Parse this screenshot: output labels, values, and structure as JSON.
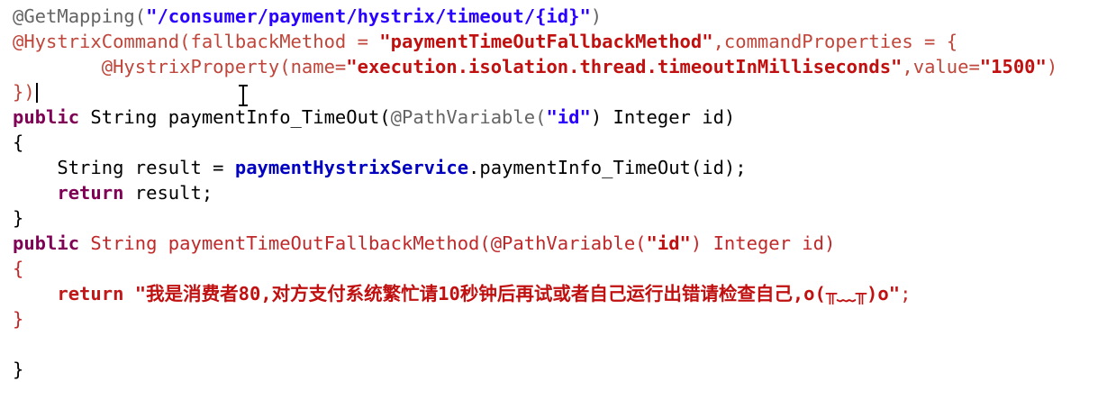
{
  "code": {
    "l1": {
      "annotation": "@GetMapping(",
      "path": "\"/consumer/payment/hystrix/timeout/{id}\"",
      "close": ")"
    },
    "l2": {
      "annotation": "@HystrixCommand(fallbackMethod = ",
      "method_name": "\"paymentTimeOutFallbackMethod\"",
      "rest": ",commandProperties = {"
    },
    "l3": {
      "indent": "        ",
      "annotation": "@HystrixProperty(name=",
      "prop_name": "\"execution.isolation.thread.timeoutInMilliseconds\"",
      "mid": ",value=",
      "prop_value": "\"1500\"",
      "close": ")"
    },
    "l4": {
      "text": "})"
    },
    "l5": {
      "kw": "public",
      "sig": " String paymentInfo_TimeOut(",
      "annotation": "@PathVariable(",
      "arg": "\"id\"",
      "rest": ") Integer id)"
    },
    "l6": {
      "text": "{"
    },
    "l7": {
      "indent": "    ",
      "pre": "String result = ",
      "field": "paymentHystrixService",
      "rest": ".paymentInfo_TimeOut(id);"
    },
    "l8": {
      "indent": "    ",
      "kw": "return",
      "rest": " result;"
    },
    "l9": {
      "text": "}"
    },
    "l10": {
      "kw": "public",
      "sig": " String paymentTimeOutFallbackMethod(",
      "annotation": "@PathVariable(",
      "arg": "\"id\"",
      "rest": ") Integer id)"
    },
    "l11": {
      "text": "{"
    },
    "l12": {
      "indent": "    ",
      "kw": "return",
      "space": " ",
      "msg": "\"我是消费者80,对方支付系统繁忙请10秒钟后再试或者自己运行出错请检查自己,o(╥﹏╥)o\"",
      "semi": ";"
    },
    "l13": {
      "text": "}"
    },
    "l14": {
      "text": ""
    },
    "l15": {
      "text": "}"
    }
  }
}
